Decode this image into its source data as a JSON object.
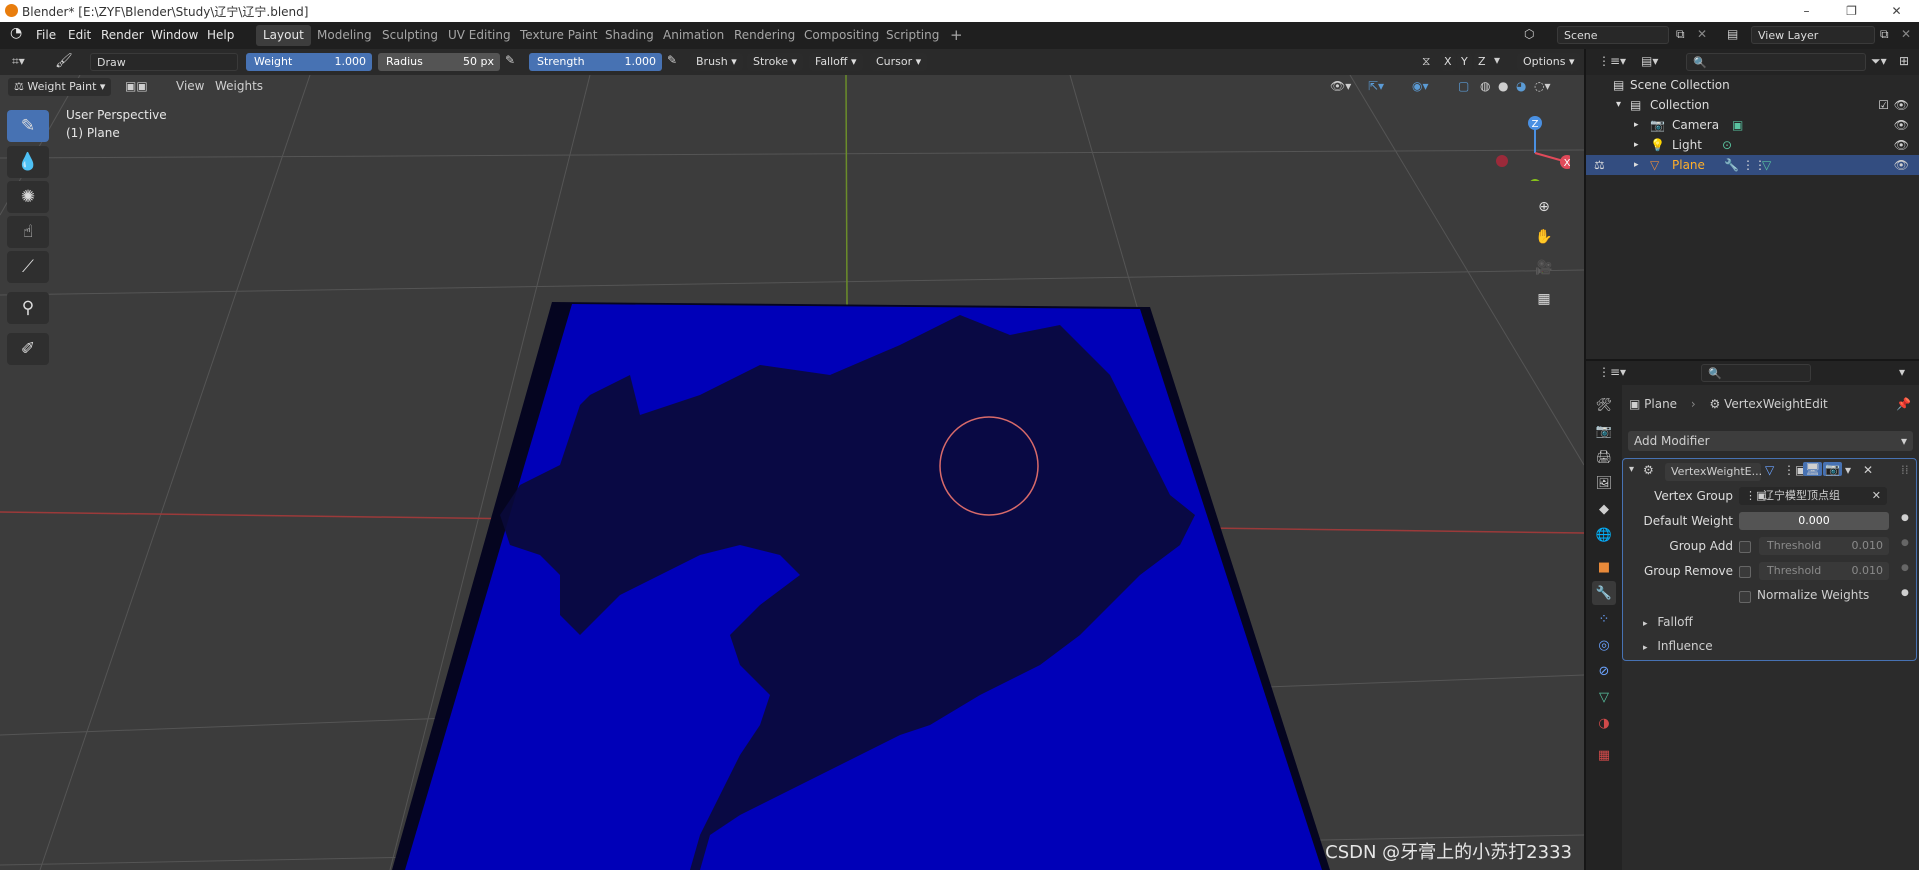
{
  "window": {
    "title": "Blender* [E:\\ZYF\\Blender\\Study\\辽宁\\辽宁.blend]"
  },
  "menu": [
    "File",
    "Edit",
    "Render",
    "Window",
    "Help"
  ],
  "workspaces": [
    "Layout",
    "Modeling",
    "Sculpting",
    "UV Editing",
    "Texture Paint",
    "Shading",
    "Animation",
    "Rendering",
    "Compositing",
    "Scripting"
  ],
  "active_workspace": "Layout",
  "scene": {
    "name": "Scene",
    "view_layer": "View Layer"
  },
  "tool_header": {
    "brush_name": "Draw",
    "weight_label": "Weight",
    "weight_value": "1.000",
    "radius_label": "Radius",
    "radius_value": "50 px",
    "strength_label": "Strength",
    "strength_value": "1.000",
    "brush_menu": "Brush",
    "stroke_menu": "Stroke",
    "falloff_menu": "Falloff",
    "cursor_menu": "Cursor",
    "axis": [
      "X",
      "Y",
      "Z"
    ],
    "options": "Options"
  },
  "viewport_header": {
    "mode": "Weight Paint",
    "view": "View",
    "weights": "Weights"
  },
  "viewport": {
    "perspective": "User Perspective",
    "object": "(1) Plane",
    "gizmo_axes": [
      "Z",
      "X"
    ]
  },
  "outliner": {
    "root": "Scene Collection",
    "collection": "Collection",
    "items": [
      {
        "name": "Camera"
      },
      {
        "name": "Light"
      },
      {
        "name": "Plane",
        "selected": true
      }
    ]
  },
  "properties": {
    "breadcrumb_object": "Plane",
    "breadcrumb_modifier": "VertexWeightEdit",
    "add_modifier": "Add Modifier",
    "modifier_name": "VertexWeightE...",
    "vertex_group_label": "Vertex Group",
    "vertex_group_value": "辽宁模型顶点组",
    "default_weight_label": "Default Weight",
    "default_weight_value": "0.000",
    "group_add_label": "Group Add",
    "group_remove_label": "Group Remove",
    "threshold_label": "Threshold",
    "threshold_add_value": "0.010",
    "threshold_remove_value": "0.010",
    "normalize_label": "Normalize Weights",
    "falloff_panel": "Falloff",
    "influence_panel": "Influence"
  },
  "watermark": "CSDN @牙膏上的小苏打2333",
  "colors": {
    "accent": "#4772b3",
    "plane": "#0000b8",
    "selection": "#334d80"
  }
}
